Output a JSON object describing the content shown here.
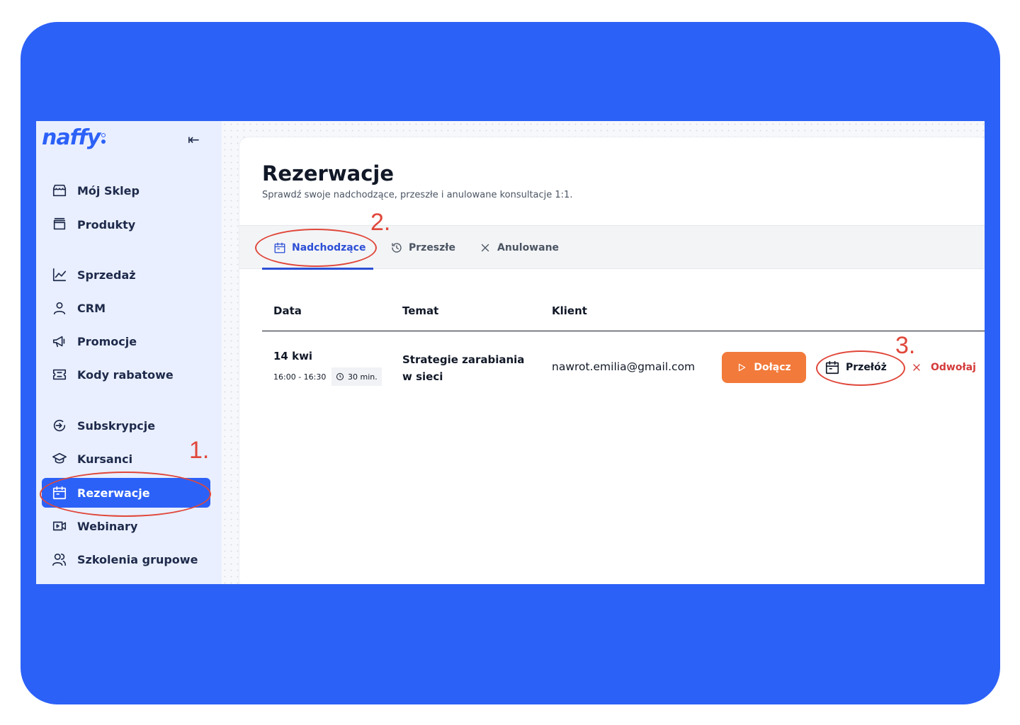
{
  "app": {
    "logo": "naffy"
  },
  "sidebar": {
    "items": [
      {
        "label": "Mój Sklep",
        "icon": "store-icon"
      },
      {
        "label": "Produkty",
        "icon": "folder-icon"
      },
      {
        "label": "Sprzedaż",
        "icon": "chart-line-icon"
      },
      {
        "label": "CRM",
        "icon": "user-icon"
      },
      {
        "label": "Promocje",
        "icon": "megaphone-icon"
      },
      {
        "label": "Kody rabatowe",
        "icon": "ticket-icon"
      },
      {
        "label": "Subskrypcje",
        "icon": "subscription-icon"
      },
      {
        "label": "Kursanci",
        "icon": "graduation-cap-icon"
      },
      {
        "label": "Rezerwacje",
        "icon": "calendar-icon",
        "active": true
      },
      {
        "label": "Webinary",
        "icon": "video-icon"
      },
      {
        "label": "Szkolenia grupowe",
        "icon": "users-icon"
      }
    ]
  },
  "page": {
    "title": "Rezerwacje",
    "subtitle": "Sprawdź swoje nadchodzące, przeszłe i anulowane konsultacje 1:1."
  },
  "tabs": [
    {
      "label": "Nadchodzące",
      "icon": "calendar-icon",
      "active": true
    },
    {
      "label": "Przeszłe",
      "icon": "history-icon"
    },
    {
      "label": "Anulowane",
      "icon": "close-icon"
    }
  ],
  "table": {
    "headers": [
      "Data",
      "Temat",
      "Klient"
    ],
    "rows": [
      {
        "date": "14 kwi",
        "time": "16:00 - 16:30",
        "duration": "30 min.",
        "topic": "Strategie zarabiania w sieci",
        "client": "nawrot.emilia@gmail.com",
        "actions": {
          "join": "Dołącz",
          "reschedule": "Przełóż",
          "cancel": "Odwołaj"
        }
      }
    ]
  },
  "annotations": [
    "1.",
    "2.",
    "3."
  ],
  "colors": {
    "brand": "#2c61f7",
    "join_button": "#f27a3a",
    "cancel_text": "#d43b3b",
    "annotation": "#e0473a"
  }
}
